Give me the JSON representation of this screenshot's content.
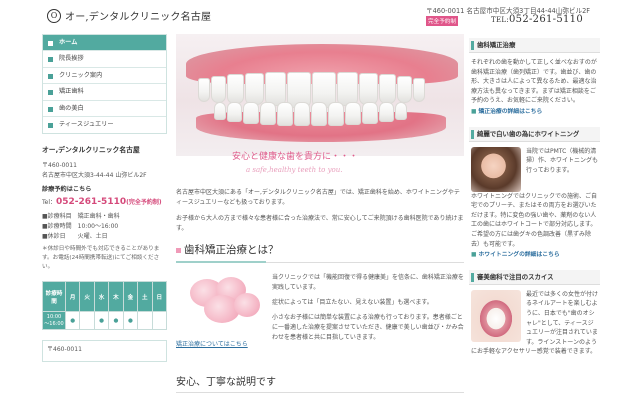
{
  "header": {
    "logo_mark": "O",
    "logo_text": "オー,デンタルクリニック名古屋",
    "address": "〒460-0011 名古屋市中区大須3丁目44-44山弥ビル2F",
    "badge": "完全予約制",
    "tel_prefix": "TEL:",
    "tel": "052-261-5110"
  },
  "nav": {
    "items": [
      "ホーム",
      "院長挨拶",
      "クリニック案内",
      "矯正歯科",
      "歯の美白",
      "ティースジュエリー"
    ]
  },
  "clinic": {
    "title": "オー,デンタルクリニック名古屋",
    "zip": "〒460-0011",
    "address": "名古屋市中区大須3-44-44 山弥ビル2F",
    "reservation_title": "診療予約はこちら",
    "tel_label": "Tel：",
    "tel": "052-261-5110",
    "tel_note": "(完全予約制)",
    "sched": [
      "■診療科目　矯正歯科・歯科",
      "■診療時間　10:00〜16:00",
      "■休診日　　火曜、土日"
    ],
    "note": "＊休診日や時間外でも対応できることがあります。お電話(24時間携帯転送)にてご相談ください。"
  },
  "calendar": {
    "corner": "診療時間",
    "days": [
      "月",
      "火",
      "水",
      "木",
      "金",
      "土",
      "日"
    ],
    "row_label": "10:00\n〜16:00",
    "marks": [
      "●",
      "",
      "●",
      "●",
      "●",
      "",
      ""
    ]
  },
  "addr_box": {
    "text": "〒460-0011"
  },
  "hero": {
    "copy": "安心と健康な歯を貴方に・・・",
    "copy_en": "a safe,healthy teeth to you."
  },
  "intro": {
    "p1": "名古屋市中区大須にある「オー,デンタルクリニック名古屋」では、矯正歯科を始め、ホワイトニングやティースジュエリーなども扱っております。",
    "p2": "お子様から大人の方まで様々な患者様に合った治療法で、常に安心してご来院頂ける歯科医院であり続けます。"
  },
  "ortho": {
    "title": "歯科矯正治療とは？",
    "p1": "当クリニックでは「機能回復で得る健康美」を信条に、歯科矯正治療を実践しています。",
    "p2": "症状によっては「目立たない、見えない装置」も選べます。",
    "p3": "小さなお子様には簡単な装置による治療も行っております。患者様ごとに一番適した治療を提案させていただき、健康で美しい歯並び・かみ合わせを患者様と共に目指していきます。",
    "link": "矯正治療についてはこちら"
  },
  "section2": {
    "title": "安心、丁寧な説明です"
  },
  "right": {
    "ortho_head": "歯科矯正治療",
    "ortho_body": "それぞれの歯を動かして正しく並べなおすのが歯科矯正治療（歯列矯正）です。歯並び、歯の形、大きさは人によって異なるため、最適な治療方法も異なってきます。まずは矯正相談をご予約のうえ、お気軽にご来院ください。",
    "ortho_link": "矯正治療の詳細はこちら",
    "white_head": "綺麗で白い歯の為にホワイトニング",
    "white_body1": "当院ではPMTC（機械的清掃）作、ホワイトニングも行っております。",
    "white_body2": "ホワイトニングではクリニックでの施術、ご自宅でのプリーチ、またはその両方をお選びいただけます。特に変色の強い歯や、薬剤のない人工の歯にはホワイトコートで部分対応します。",
    "white_body3": "ご希望の方には歯グキの色調改善（黒ずみ除去）も可能です。",
    "white_link": "ホワイトニングの詳細はこちら",
    "jewel_head": "審美歯科で注目のスカイス",
    "jewel_body": "最近では多くの女性が付けるネイルアートを楽しむように、日本でも\"歯のオシャレ\"として、ティースジュエリーが注目されています。ラインストーンのようにお手軽なアクセサリー感覚で装着できます。"
  }
}
